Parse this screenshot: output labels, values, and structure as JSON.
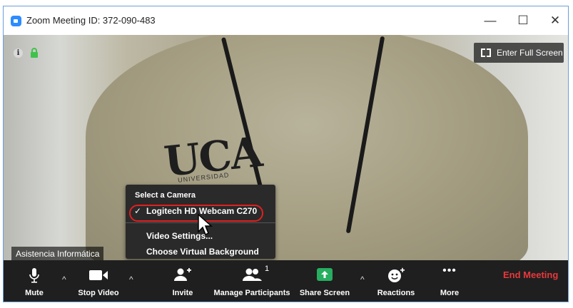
{
  "window": {
    "title": "Zoom Meeting ID: 372-090-483",
    "controls": [
      "—",
      "☐",
      "✕"
    ]
  },
  "video": {
    "fullscreen_label": "Enter Full Screen",
    "participant_name": "Asistencia Informática",
    "logo_text": "UCA",
    "logo_sub": "UNIVERSIDAD"
  },
  "camera_menu": {
    "header": "Select a Camera",
    "selected_camera": "Logitech HD Webcam C270",
    "check": "✓",
    "items": [
      "Video Settings...",
      "Choose Virtual Background"
    ]
  },
  "toolbar": {
    "mute": "Mute",
    "stop_video": "Stop Video",
    "invite": "Invite",
    "manage_participants": "Manage Participants",
    "participant_count": "1",
    "share_screen": "Share Screen",
    "reactions": "Reactions",
    "more": "More",
    "more_glyph": "•••",
    "end_meeting": "End Meeting",
    "caret": "^"
  },
  "colors": {
    "accent": "#2d8cff",
    "end": "#e8383d",
    "share": "#27ae60",
    "highlight": "#e02020"
  }
}
